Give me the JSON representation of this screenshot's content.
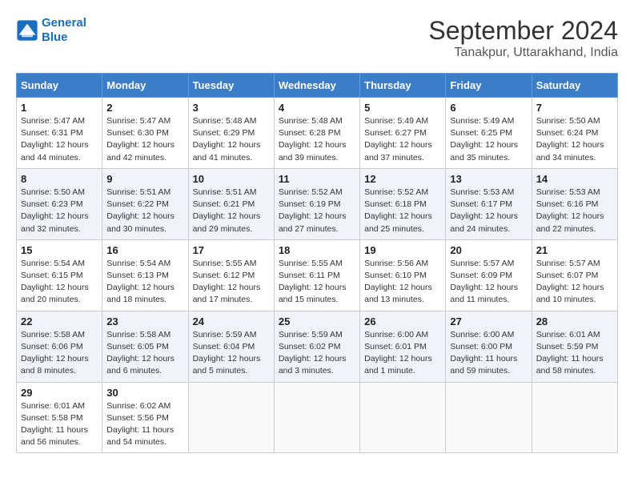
{
  "header": {
    "logo_line1": "General",
    "logo_line2": "Blue",
    "month": "September 2024",
    "location": "Tanakpur, Uttarakhand, India"
  },
  "weekdays": [
    "Sunday",
    "Monday",
    "Tuesday",
    "Wednesday",
    "Thursday",
    "Friday",
    "Saturday"
  ],
  "weeks": [
    [
      {
        "day": "1",
        "info": "Sunrise: 5:47 AM\nSunset: 6:31 PM\nDaylight: 12 hours\nand 44 minutes."
      },
      {
        "day": "2",
        "info": "Sunrise: 5:47 AM\nSunset: 6:30 PM\nDaylight: 12 hours\nand 42 minutes."
      },
      {
        "day": "3",
        "info": "Sunrise: 5:48 AM\nSunset: 6:29 PM\nDaylight: 12 hours\nand 41 minutes."
      },
      {
        "day": "4",
        "info": "Sunrise: 5:48 AM\nSunset: 6:28 PM\nDaylight: 12 hours\nand 39 minutes."
      },
      {
        "day": "5",
        "info": "Sunrise: 5:49 AM\nSunset: 6:27 PM\nDaylight: 12 hours\nand 37 minutes."
      },
      {
        "day": "6",
        "info": "Sunrise: 5:49 AM\nSunset: 6:25 PM\nDaylight: 12 hours\nand 35 minutes."
      },
      {
        "day": "7",
        "info": "Sunrise: 5:50 AM\nSunset: 6:24 PM\nDaylight: 12 hours\nand 34 minutes."
      }
    ],
    [
      {
        "day": "8",
        "info": "Sunrise: 5:50 AM\nSunset: 6:23 PM\nDaylight: 12 hours\nand 32 minutes."
      },
      {
        "day": "9",
        "info": "Sunrise: 5:51 AM\nSunset: 6:22 PM\nDaylight: 12 hours\nand 30 minutes."
      },
      {
        "day": "10",
        "info": "Sunrise: 5:51 AM\nSunset: 6:21 PM\nDaylight: 12 hours\nand 29 minutes."
      },
      {
        "day": "11",
        "info": "Sunrise: 5:52 AM\nSunset: 6:19 PM\nDaylight: 12 hours\nand 27 minutes."
      },
      {
        "day": "12",
        "info": "Sunrise: 5:52 AM\nSunset: 6:18 PM\nDaylight: 12 hours\nand 25 minutes."
      },
      {
        "day": "13",
        "info": "Sunrise: 5:53 AM\nSunset: 6:17 PM\nDaylight: 12 hours\nand 24 minutes."
      },
      {
        "day": "14",
        "info": "Sunrise: 5:53 AM\nSunset: 6:16 PM\nDaylight: 12 hours\nand 22 minutes."
      }
    ],
    [
      {
        "day": "15",
        "info": "Sunrise: 5:54 AM\nSunset: 6:15 PM\nDaylight: 12 hours\nand 20 minutes."
      },
      {
        "day": "16",
        "info": "Sunrise: 5:54 AM\nSunset: 6:13 PM\nDaylight: 12 hours\nand 18 minutes."
      },
      {
        "day": "17",
        "info": "Sunrise: 5:55 AM\nSunset: 6:12 PM\nDaylight: 12 hours\nand 17 minutes."
      },
      {
        "day": "18",
        "info": "Sunrise: 5:55 AM\nSunset: 6:11 PM\nDaylight: 12 hours\nand 15 minutes."
      },
      {
        "day": "19",
        "info": "Sunrise: 5:56 AM\nSunset: 6:10 PM\nDaylight: 12 hours\nand 13 minutes."
      },
      {
        "day": "20",
        "info": "Sunrise: 5:57 AM\nSunset: 6:09 PM\nDaylight: 12 hours\nand 11 minutes."
      },
      {
        "day": "21",
        "info": "Sunrise: 5:57 AM\nSunset: 6:07 PM\nDaylight: 12 hours\nand 10 minutes."
      }
    ],
    [
      {
        "day": "22",
        "info": "Sunrise: 5:58 AM\nSunset: 6:06 PM\nDaylight: 12 hours\nand 8 minutes."
      },
      {
        "day": "23",
        "info": "Sunrise: 5:58 AM\nSunset: 6:05 PM\nDaylight: 12 hours\nand 6 minutes."
      },
      {
        "day": "24",
        "info": "Sunrise: 5:59 AM\nSunset: 6:04 PM\nDaylight: 12 hours\nand 5 minutes."
      },
      {
        "day": "25",
        "info": "Sunrise: 5:59 AM\nSunset: 6:02 PM\nDaylight: 12 hours\nand 3 minutes."
      },
      {
        "day": "26",
        "info": "Sunrise: 6:00 AM\nSunset: 6:01 PM\nDaylight: 12 hours\nand 1 minute."
      },
      {
        "day": "27",
        "info": "Sunrise: 6:00 AM\nSunset: 6:00 PM\nDaylight: 11 hours\nand 59 minutes."
      },
      {
        "day": "28",
        "info": "Sunrise: 6:01 AM\nSunset: 5:59 PM\nDaylight: 11 hours\nand 58 minutes."
      }
    ],
    [
      {
        "day": "29",
        "info": "Sunrise: 6:01 AM\nSunset: 5:58 PM\nDaylight: 11 hours\nand 56 minutes."
      },
      {
        "day": "30",
        "info": "Sunrise: 6:02 AM\nSunset: 5:56 PM\nDaylight: 11 hours\nand 54 minutes."
      },
      {
        "day": "",
        "info": ""
      },
      {
        "day": "",
        "info": ""
      },
      {
        "day": "",
        "info": ""
      },
      {
        "day": "",
        "info": ""
      },
      {
        "day": "",
        "info": ""
      }
    ]
  ]
}
